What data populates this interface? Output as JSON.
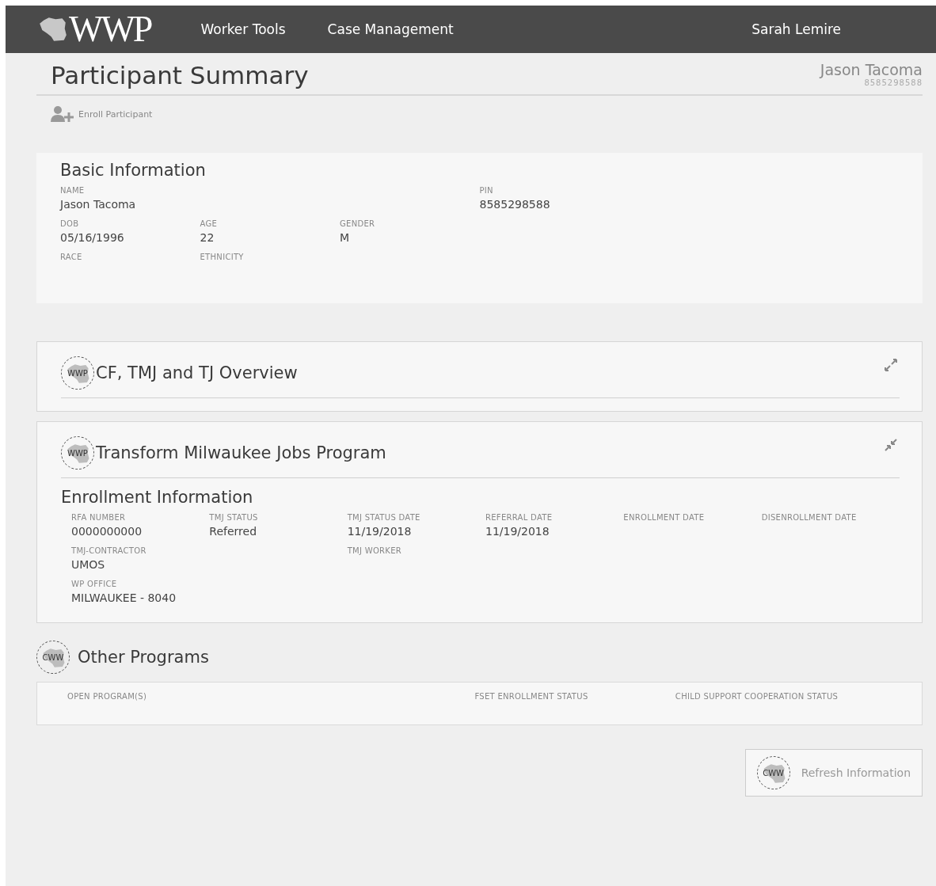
{
  "header": {
    "logo_text": "WWP",
    "nav": [
      {
        "label": "Worker Tools"
      },
      {
        "label": "Case Management"
      }
    ],
    "user": "Sarah Lemire"
  },
  "page": {
    "title": "Participant Summary",
    "participant_name": "Jason Tacoma",
    "participant_pin": "8585298588"
  },
  "actions": [
    {
      "label": "Enroll Participant"
    }
  ],
  "basic_information": {
    "title": "Basic Information",
    "rows": [
      [
        {
          "label": "NAME",
          "value": "Jason Tacoma"
        },
        {
          "label": "PIN",
          "value": "8585298588"
        }
      ],
      [
        {
          "label": "DOB",
          "value": "05/16/1996"
        },
        {
          "label": "AGE",
          "value": "22"
        },
        {
          "label": "GENDER",
          "value": "M"
        }
      ],
      [
        {
          "label": "RACE"
        },
        {
          "label": "ETHNICITY"
        }
      ]
    ]
  },
  "panels": [
    {
      "badge": "WWP",
      "title": "CF, TMJ and TJ Overview",
      "expanded": false
    },
    {
      "badge": "WWP",
      "title": "Transform Milwaukee Jobs Program",
      "expanded": true,
      "section_title": "Enrollment Information",
      "rows": [
        [
          {
            "label": "RFA NUMBER",
            "value": "0000000000"
          },
          {
            "label": "TMJ STATUS",
            "value": "Referred"
          },
          {
            "label": "TMJ STATUS DATE",
            "value": "11/19/2018"
          },
          {
            "label": "REFERRAL DATE",
            "value": "11/19/2018"
          },
          {
            "label": "ENROLLMENT DATE"
          },
          {
            "label": "DISENROLLMENT DATE"
          }
        ],
        [
          {
            "label": "TMJ-CONTRACTOR",
            "value": "UMOS"
          },
          {},
          {
            "label": "TMJ WORKER"
          }
        ],
        [
          {
            "label": "WP OFFICE",
            "value": "MILWAUKEE - 8040"
          }
        ]
      ]
    }
  ],
  "other_programs": {
    "badge": "CWW",
    "title": "Other Programs",
    "columns": [
      {
        "label": "OPEN PROGRAM(S)"
      },
      {
        "label": "FSET ENROLLMENT STATUS"
      },
      {
        "label": "CHILD SUPPORT COOPERATION STATUS"
      }
    ]
  },
  "refresh_button": {
    "badge": "CWW",
    "label": "Refresh Information"
  }
}
